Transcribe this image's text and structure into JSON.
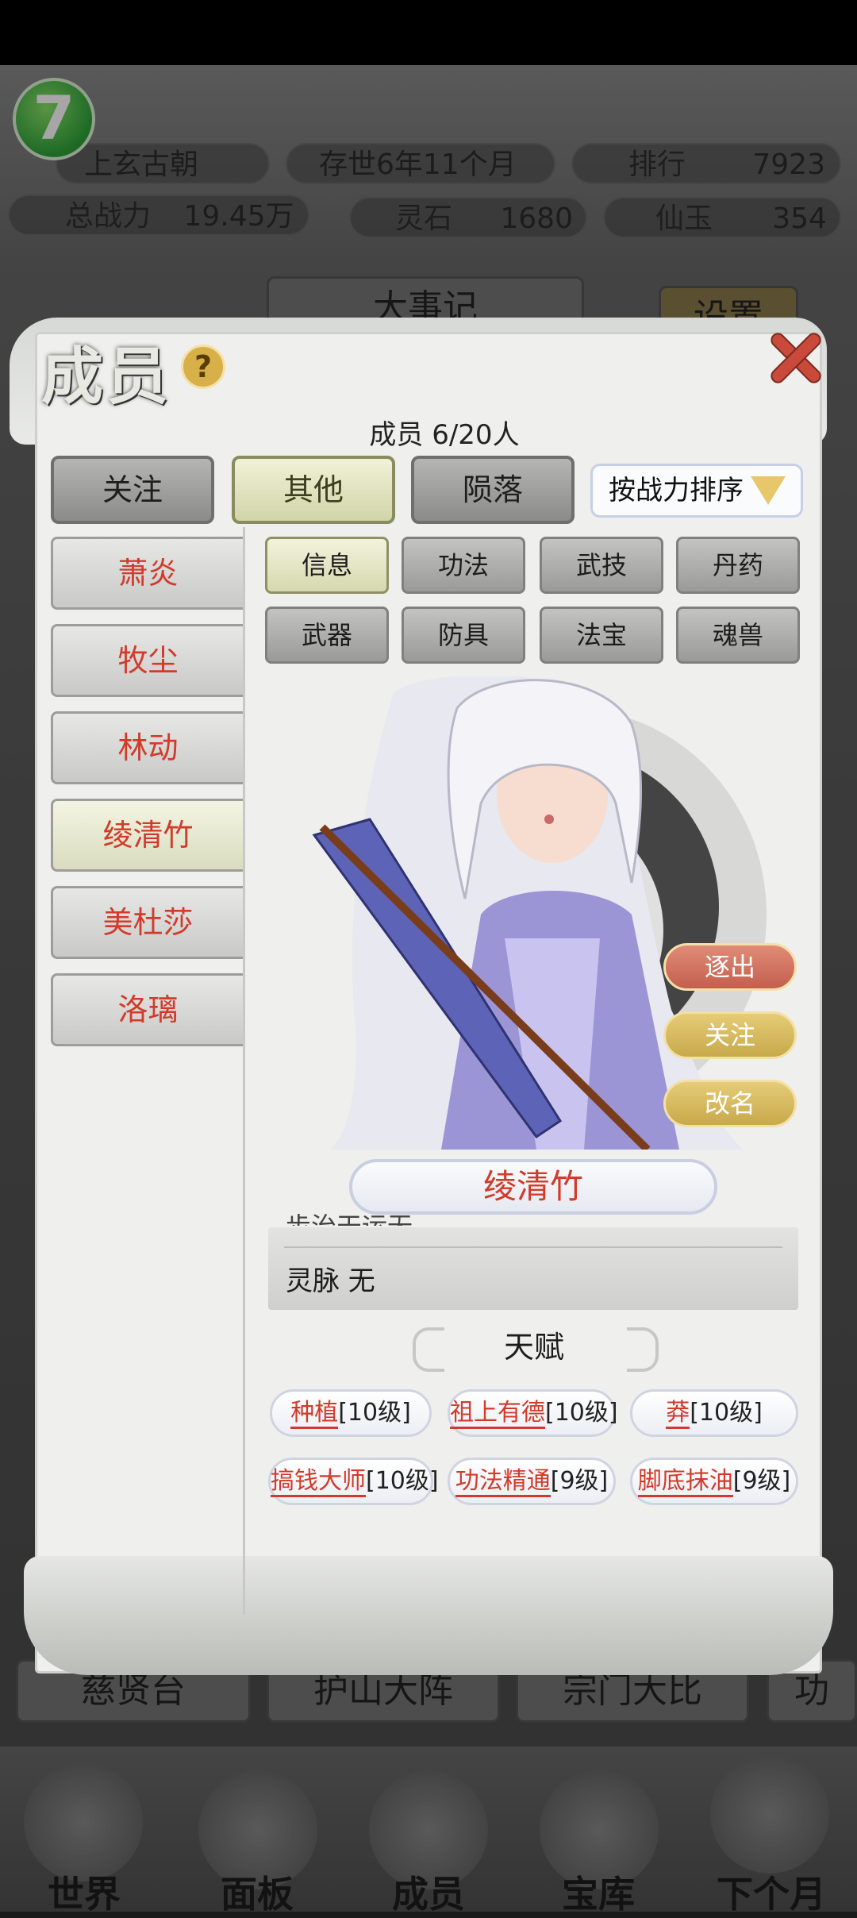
{
  "hud": {
    "sect_name": "上玄古朝",
    "age": "存世6年11个月",
    "rank_label": "排行",
    "rank_value": "7923",
    "power_label": "总战力",
    "power_value": "19.45万",
    "spirit_stone_label": "灵石",
    "spirit_stone_value": "1680",
    "jade_label": "仙玉",
    "jade_value": "354",
    "logo_text": "7"
  },
  "background": {
    "events_title": "大事记",
    "settings_label": "设置",
    "bottom_buttons": [
      "慈贤台",
      "护山大阵",
      "宗门大比",
      "功"
    ],
    "nav": [
      "世界",
      "面板",
      "成员",
      "宝库",
      "下个月"
    ]
  },
  "dialog": {
    "title": "成员",
    "help_label": "?",
    "member_count": "成员  6/20人",
    "tabs": [
      "关注",
      "其他",
      "陨落"
    ],
    "sort_label": "按战力排序",
    "members": [
      "萧炎",
      "牧尘",
      "林动",
      "绫清竹",
      "美杜莎",
      "洛璃"
    ],
    "sub_tabs": [
      "信息",
      "功法",
      "武技",
      "丹药",
      "武器",
      "防具",
      "法宝",
      "魂兽"
    ],
    "actions": {
      "expel": "逐出",
      "follow": "关注",
      "rename": "改名"
    },
    "selected_name": "绫清竹",
    "info_cut_row": "步治天运无",
    "info_row": "灵脉 无",
    "talent_title": "天赋",
    "talents": [
      {
        "name": "种植",
        "level": "[10级]"
      },
      {
        "name": "祖上有德",
        "level": "[10级]"
      },
      {
        "name": "莽",
        "level": "[10级]"
      },
      {
        "name": "搞钱大师",
        "level": "[10级]"
      },
      {
        "name": "功法精通",
        "level": "[9级]"
      },
      {
        "name": "脚底抹油",
        "level": "[9级]"
      }
    ]
  }
}
